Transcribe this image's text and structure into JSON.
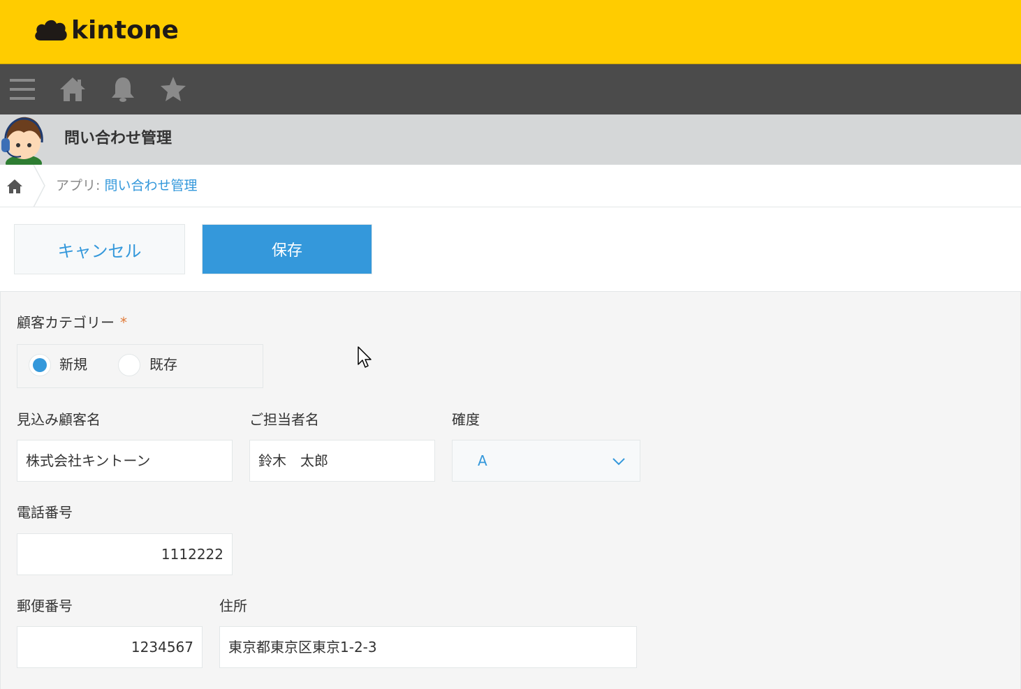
{
  "header": {
    "logo_text": "kintone",
    "background": "#ffcc00"
  },
  "navbar": {
    "icons": [
      "menu-icon",
      "home-icon",
      "bell-icon",
      "star-icon"
    ]
  },
  "app": {
    "title": "問い合わせ管理"
  },
  "breadcrumb": {
    "prefix": "アプリ: ",
    "app_link": "問い合わせ管理"
  },
  "actions": {
    "cancel_label": "キャンセル",
    "save_label": "保存",
    "accent": "#3498db"
  },
  "form": {
    "category": {
      "label": "顧客カテゴリー",
      "required_mark": "*",
      "options": [
        {
          "label": "新規",
          "selected": true
        },
        {
          "label": "既存",
          "selected": false
        }
      ]
    },
    "prospect_name": {
      "label": "見込み顧客名",
      "value": "株式会社キントーン"
    },
    "contact_name": {
      "label": "ご担当者名",
      "value": "鈴木　太郎"
    },
    "certainty": {
      "label": "確度",
      "value": "A"
    },
    "phone": {
      "label": "電話番号",
      "value": "1112222"
    },
    "postal_code": {
      "label": "郵便番号",
      "value": "1234567"
    },
    "address": {
      "label": "住所",
      "value": "東京都東京区東京1-2-3"
    }
  }
}
